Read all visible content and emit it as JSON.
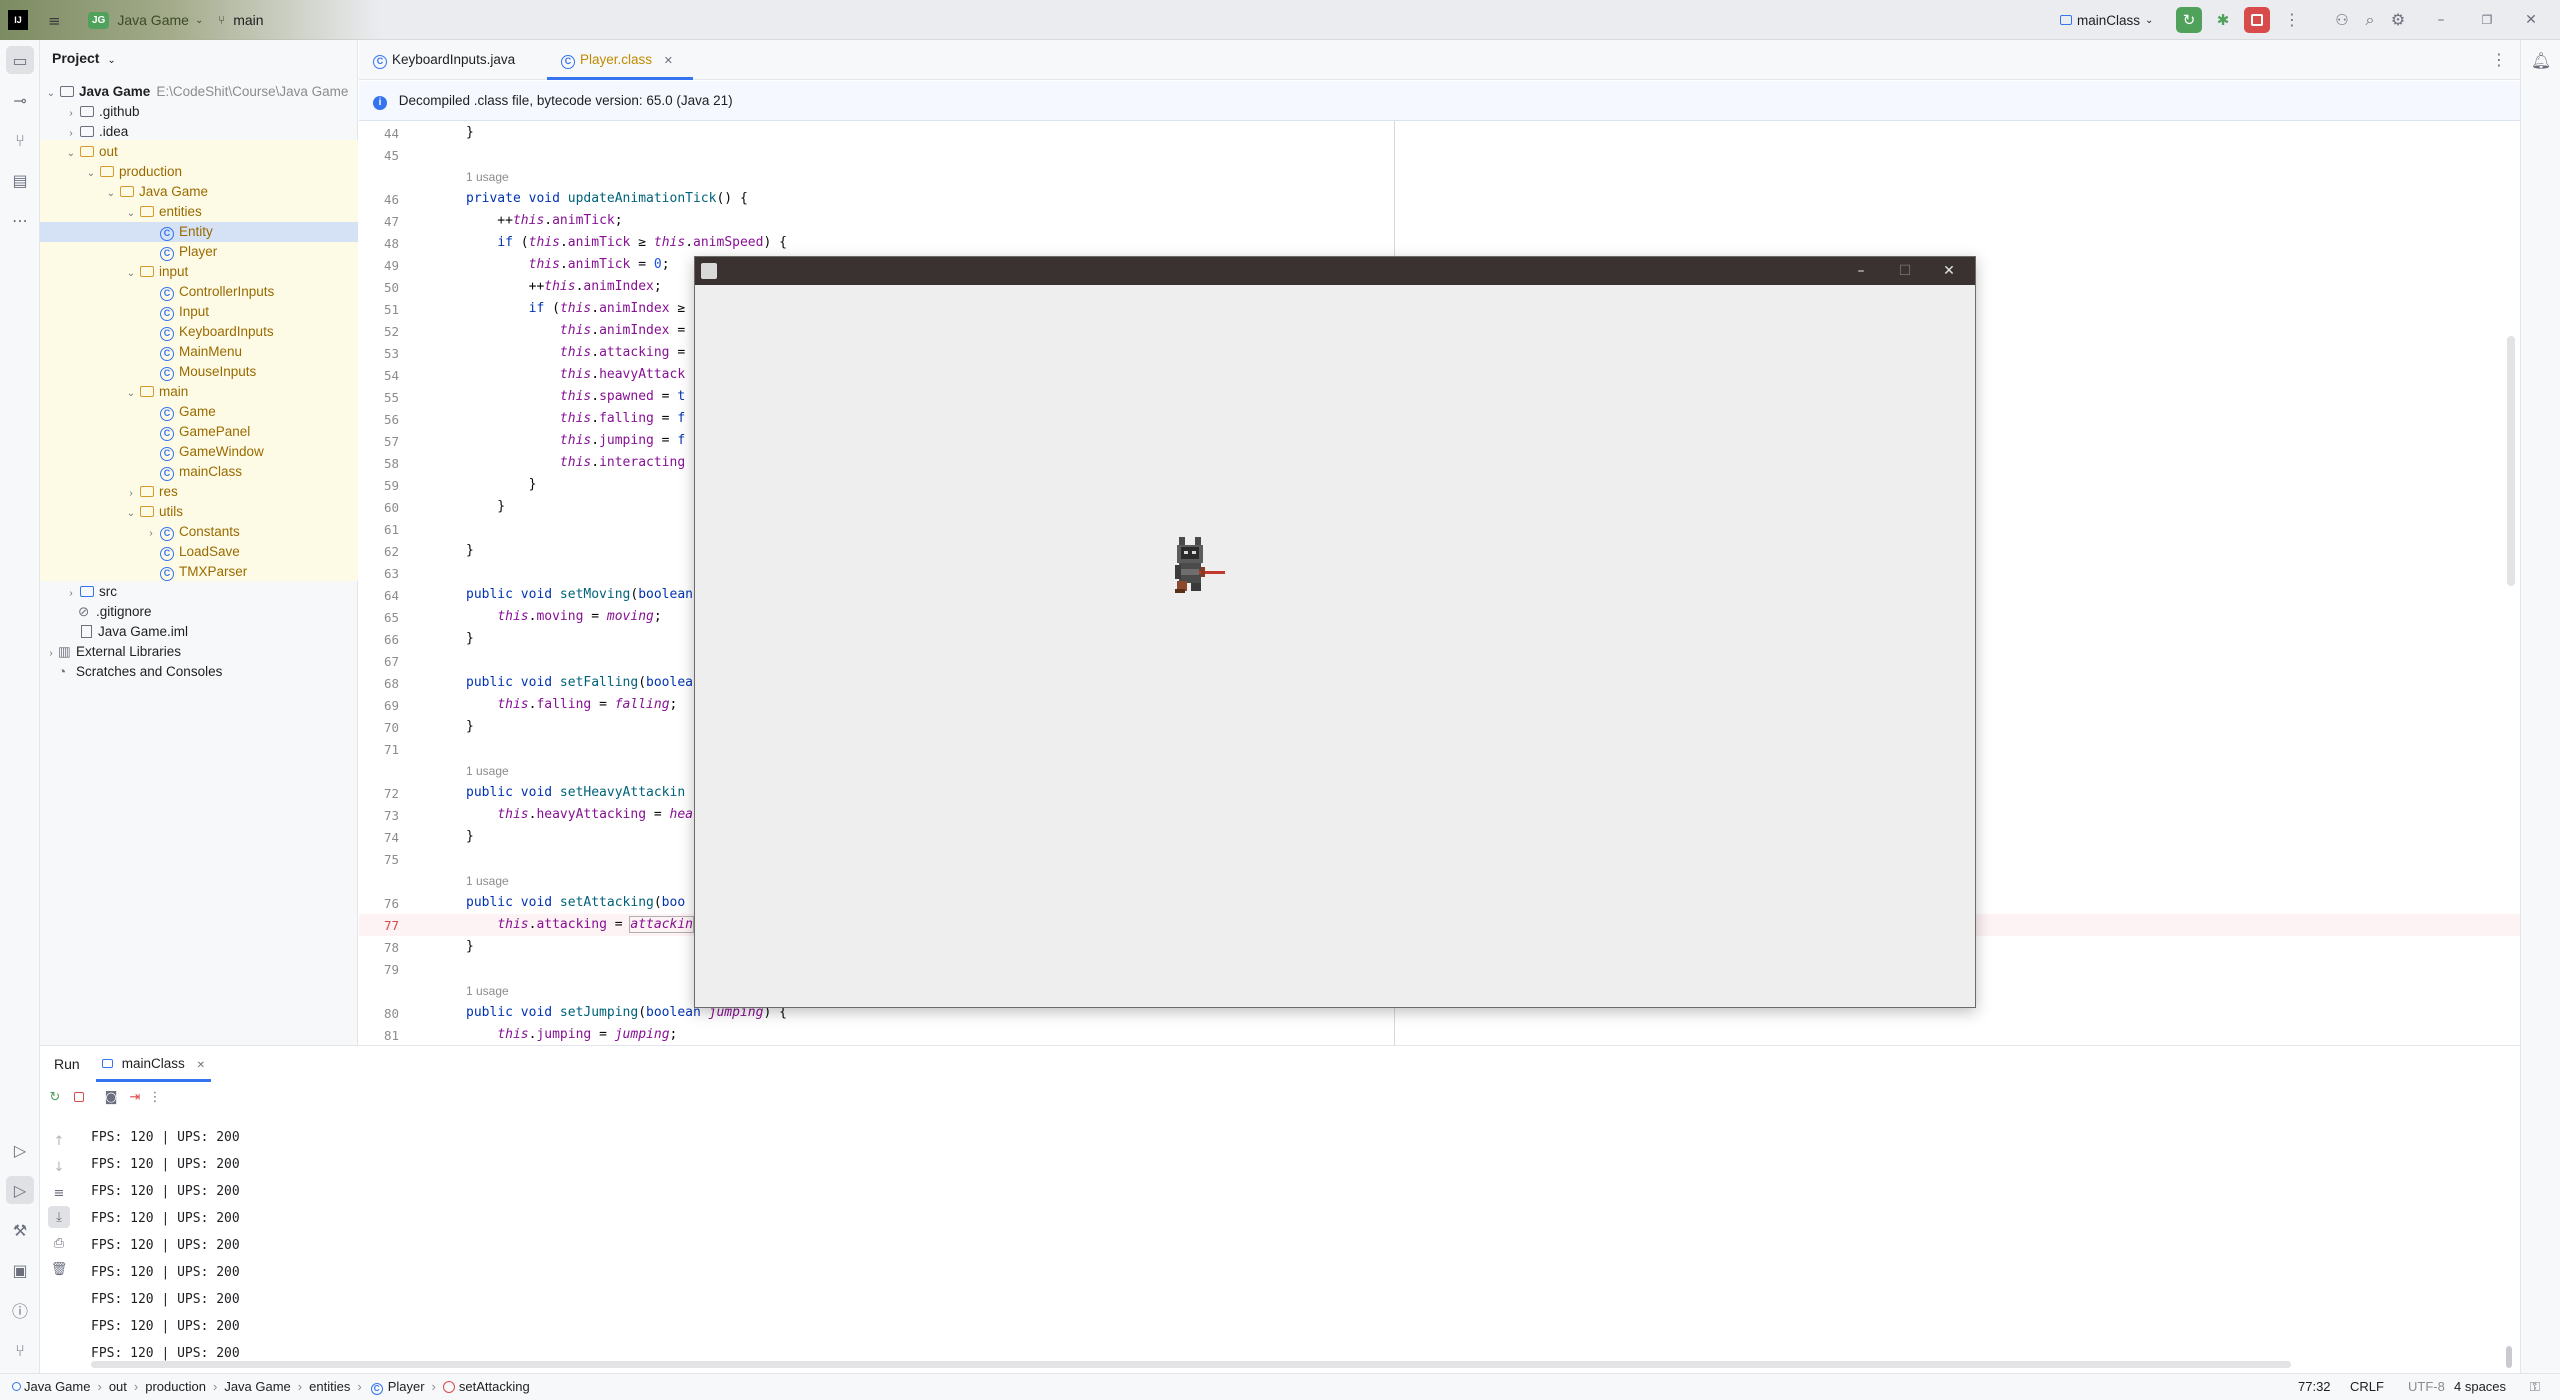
{
  "titlebar": {
    "project_badge": "JG",
    "project_name": "Java Game",
    "branch": "main",
    "run_config": "mainClass"
  },
  "project_panel": {
    "title": "Project",
    "tree": [
      {
        "label": "Java Game",
        "path": "E:\\CodeShit\\Course\\Java Game",
        "icon": "folder"
      },
      {
        "label": ".github",
        "icon": "folder"
      },
      {
        "label": ".idea",
        "icon": "folder"
      },
      {
        "label": "out",
        "icon": "folder"
      },
      {
        "label": "production",
        "icon": "folder"
      },
      {
        "label": "Java Game",
        "icon": "folder"
      },
      {
        "label": "entities",
        "icon": "folder"
      },
      {
        "label": "Entity",
        "icon": "class"
      },
      {
        "label": "Player",
        "icon": "class"
      },
      {
        "label": "input",
        "icon": "folder"
      },
      {
        "label": "ControllerInputs",
        "icon": "class"
      },
      {
        "label": "Input",
        "icon": "class"
      },
      {
        "label": "KeyboardInputs",
        "icon": "class"
      },
      {
        "label": "MainMenu",
        "icon": "class"
      },
      {
        "label": "MouseInputs",
        "icon": "class"
      },
      {
        "label": "main",
        "icon": "folder"
      },
      {
        "label": "Game",
        "icon": "class"
      },
      {
        "label": "GamePanel",
        "icon": "class"
      },
      {
        "label": "GameWindow",
        "icon": "class"
      },
      {
        "label": "mainClass",
        "icon": "class"
      },
      {
        "label": "res",
        "icon": "folder"
      },
      {
        "label": "utils",
        "icon": "folder"
      },
      {
        "label": "Constants",
        "icon": "class"
      },
      {
        "label": "LoadSave",
        "icon": "class"
      },
      {
        "label": "TMXParser",
        "icon": "class"
      },
      {
        "label": "src",
        "icon": "folder"
      },
      {
        "label": ".gitignore",
        "icon": "file"
      },
      {
        "label": "Java Game.iml",
        "icon": "file"
      },
      {
        "label": "External Libraries",
        "icon": "library"
      },
      {
        "label": "Scratches and Consoles",
        "icon": "scratch"
      }
    ]
  },
  "editor": {
    "tabs": [
      {
        "label": "KeyboardInputs.java"
      },
      {
        "label": "Player.class"
      }
    ],
    "banner": "Decompiled .class file, bytecode version: 65.0 (Java 21)",
    "usage_hint": "1 usage",
    "line_numbers": [
      "44",
      "45",
      "46",
      "47",
      "48",
      "49",
      "50",
      "51",
      "52",
      "53",
      "54",
      "55",
      "56",
      "57",
      "58",
      "59",
      "60",
      "61",
      "62",
      "63",
      "64",
      "65",
      "66",
      "67",
      "68",
      "69",
      "70",
      "71",
      "72",
      "73",
      "74",
      "75",
      "76",
      "77",
      "78",
      "79",
      "80",
      "81"
    ]
  },
  "game_window": {
    "title": ""
  },
  "run_panel": {
    "title": "Run",
    "tab": "mainClass",
    "console_lines": [
      "FPS: 120 | UPS: 200",
      "FPS: 120 | UPS: 200",
      "FPS: 120 | UPS: 200",
      "FPS: 120 | UPS: 200",
      "FPS: 120 | UPS: 200",
      "FPS: 120 | UPS: 200",
      "FPS: 120 | UPS: 200",
      "FPS: 120 | UPS: 200",
      "FPS: 120 | UPS: 200",
      "FPS: 120 | UPS: 200"
    ]
  },
  "statusbar": {
    "breadcrumbs": [
      "Java Game",
      "out",
      "production",
      "Java Game",
      "entities",
      "Player",
      "setAttacking"
    ],
    "position": "77:32",
    "line_ending": "CRLF",
    "encoding": "UTF-8",
    "indent": "4 spaces"
  },
  "colors": {
    "accent": "#3574f0",
    "run_green": "#4fa15b",
    "stop_red": "#d94a4a"
  }
}
